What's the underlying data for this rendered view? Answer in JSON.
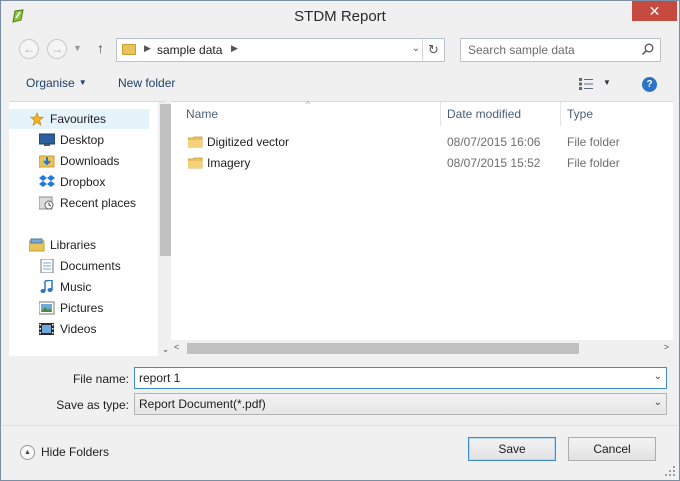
{
  "window": {
    "title": "STDM Report",
    "close_symbol": "✕"
  },
  "address_bar": {
    "path_segments": [
      "sample data"
    ],
    "search_placeholder": "Search sample data"
  },
  "toolbar": {
    "organise_label": "Organise",
    "new_folder_label": "New folder",
    "help_symbol": "?"
  },
  "navigation": {
    "favourites": {
      "label": "Favourites",
      "items": [
        {
          "label": "Desktop",
          "icon": "desktop-icon"
        },
        {
          "label": "Downloads",
          "icon": "downloads-icon"
        },
        {
          "label": "Dropbox",
          "icon": "dropbox-icon"
        },
        {
          "label": "Recent places",
          "icon": "recent-places-icon"
        }
      ]
    },
    "libraries": {
      "label": "Libraries",
      "items": [
        {
          "label": "Documents",
          "icon": "documents-icon"
        },
        {
          "label": "Music",
          "icon": "music-icon"
        },
        {
          "label": "Pictures",
          "icon": "pictures-icon"
        },
        {
          "label": "Videos",
          "icon": "videos-icon"
        }
      ]
    }
  },
  "file_list": {
    "columns": [
      "Name",
      "Date modified",
      "Type"
    ],
    "rows": [
      {
        "name": "Digitized vector",
        "date_modified": "08/07/2015 16:06",
        "type": "File folder"
      },
      {
        "name": "Imagery",
        "date_modified": "08/07/2015 15:52",
        "type": "File folder"
      }
    ]
  },
  "form": {
    "file_name_label": "File name:",
    "file_name_value": "report 1",
    "save_as_type_label": "Save as type:",
    "save_as_type_value": "Report Document(*.pdf)"
  },
  "footer": {
    "hide_folders_label": "Hide Folders",
    "save_label": "Save",
    "cancel_label": "Cancel"
  },
  "colors": {
    "accent": "#3f8bd1",
    "close_button": "#c74a40",
    "folder": "#e8c35c",
    "selection": "#e5f3fb"
  }
}
